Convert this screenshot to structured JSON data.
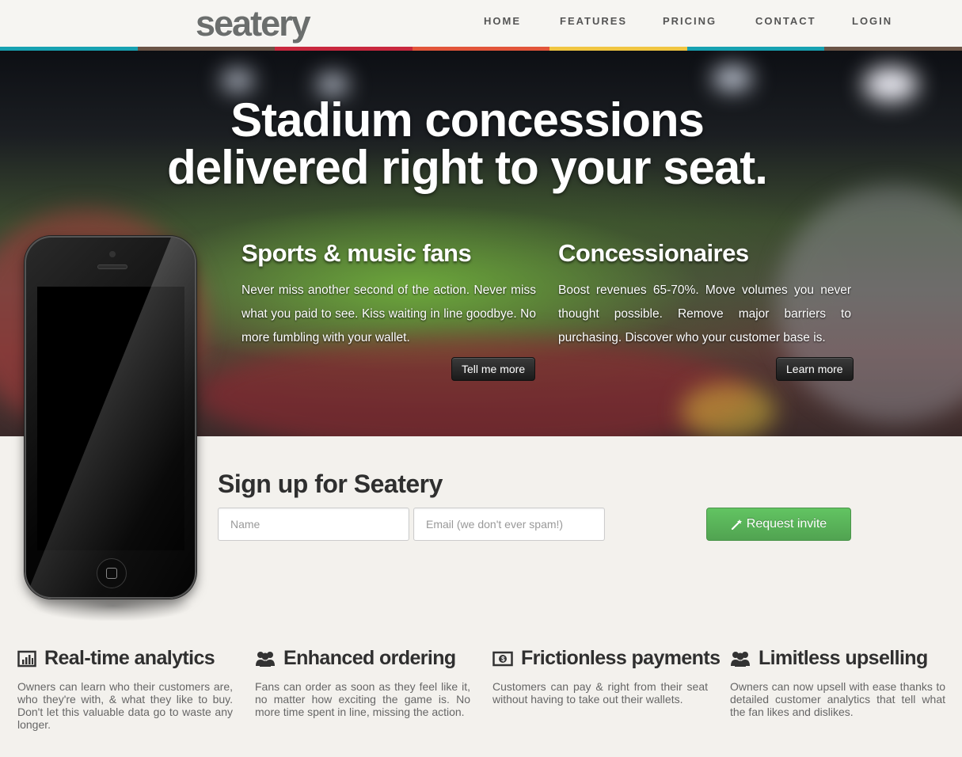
{
  "header": {
    "logo": "seatery",
    "nav": [
      "HOME",
      "FEATURES",
      "PRICING",
      "CONTACT",
      "LOGIN"
    ]
  },
  "colors": {
    "stripe": [
      "#18a1b1",
      "#6a5446",
      "#c8283e",
      "#e2553a",
      "#f0c541",
      "#18a1b1",
      "#6a5446"
    ],
    "accent_green": "#5bb75b"
  },
  "hero": {
    "title_line1": "Stadium concessions",
    "title_line2": "delivered right to your seat.",
    "fans": {
      "heading": "Sports & music fans",
      "body": "Never miss another second of the action. Never miss what you paid to see. Kiss waiting in line goodbye. No more fumbling with your wallet.",
      "button": "Tell me more"
    },
    "concessionaires": {
      "heading": "Concessionaires",
      "body": "Boost revenues 65-70%. Move volumes you never thought possible. Remove major barriers to purchasing. Discover who your customer base is.",
      "button": "Learn more"
    }
  },
  "signup": {
    "title": "Sign up for Seatery",
    "name_placeholder": "Name",
    "email_placeholder": "Email (we don't ever spam!)",
    "button": "Request invite"
  },
  "features": [
    {
      "icon": "bar-chart-icon",
      "title": "Real-time analytics",
      "body": "Owners can learn who their customers are, who they're with, & what they like to buy. Don't let this valuable data go to waste any longer."
    },
    {
      "icon": "group-icon",
      "title": "Enhanced ordering",
      "body": "Fans can order as soon as they feel like it, no matter how exciting the game is. No more time spent in line, missing the action."
    },
    {
      "icon": "money-icon",
      "title": "Frictionless payments",
      "body": "Customers can pay & right from their seat without having to take out their wallets."
    },
    {
      "icon": "group-icon",
      "title": "Limitless upselling",
      "body": "Owners can now upsell with ease thanks to detailed customer analytics that tell what the fan likes and dislikes."
    }
  ]
}
